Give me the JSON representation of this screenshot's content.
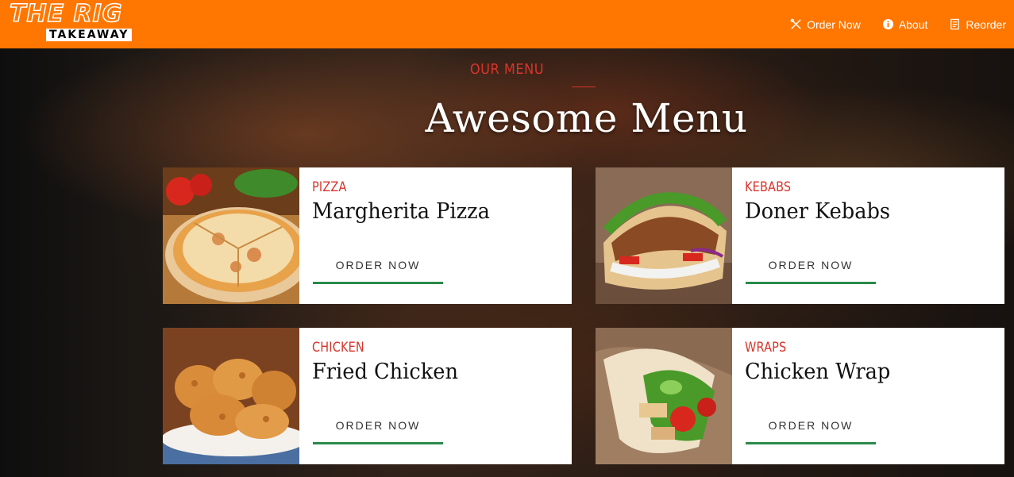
{
  "brand": {
    "name": "THE RIG",
    "tagline": "TAKEAWAY"
  },
  "nav": {
    "items": [
      {
        "label": "Order Now",
        "icon": "utensils-icon"
      },
      {
        "label": "About",
        "icon": "info-icon"
      },
      {
        "label": "Reorder",
        "icon": "receipt-icon"
      }
    ]
  },
  "menu": {
    "kicker": "OUR MENU",
    "title": "Awesome Menu",
    "cards": [
      {
        "category": "PIZZA",
        "name": "Margherita Pizza",
        "button": "ORDER NOW"
      },
      {
        "category": "KEBABS",
        "name": "Doner Kebabs",
        "button": "ORDER NOW"
      },
      {
        "category": "CHICKEN",
        "name": "Fried Chicken",
        "button": "ORDER NOW"
      },
      {
        "category": "WRAPS",
        "name": "Chicken Wrap",
        "button": "ORDER NOW"
      }
    ]
  },
  "colors": {
    "header": "#ff7700",
    "accent_red": "#d9342b",
    "button_underline": "#2a8a4a"
  }
}
